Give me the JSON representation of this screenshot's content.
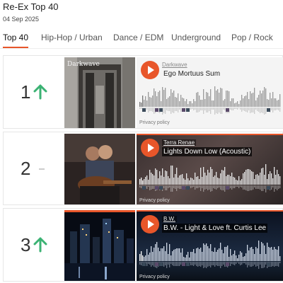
{
  "header": {
    "title": "Re-Ex Top 40",
    "date": "04 Sep 2025"
  },
  "tabs": [
    {
      "label": "Top 40",
      "active": true
    },
    {
      "label": "Hip-Hop / Urban",
      "active": false
    },
    {
      "label": "Dance / EDM",
      "active": false
    },
    {
      "label": "Underground",
      "active": false
    },
    {
      "label": "Pop / Rock",
      "active": false
    }
  ],
  "entries": [
    {
      "rank": "1",
      "trend": "up",
      "artist": "Darkwave",
      "track": "Ego Mortuus Sum",
      "cover_text": "Darkwave",
      "privacy": "Privacy policy"
    },
    {
      "rank": "2",
      "trend": "same",
      "artist": "Terra Renae",
      "track": "Lights Down Low (Acoustic)",
      "privacy": "Privacy policy"
    },
    {
      "rank": "3",
      "trend": "up",
      "artist": "B.W.",
      "track": "B.W. - Light & Love ft. Curtis Lee",
      "privacy": "Privacy policy"
    }
  ],
  "colors": {
    "accent": "#e8562a",
    "trend_up": "#3bb273"
  }
}
